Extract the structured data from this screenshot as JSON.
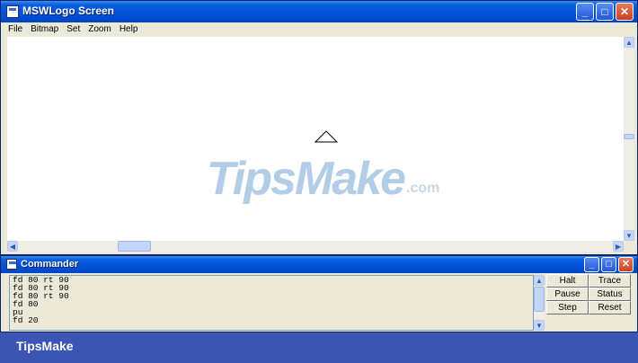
{
  "main_window": {
    "title": "MSWLogo Screen",
    "controls": {
      "minimize": "_",
      "maximize": "□",
      "close": "✕"
    },
    "menu": [
      "File",
      "Bitmap",
      "Set",
      "Zoom",
      "Help"
    ]
  },
  "canvas": {
    "watermark_main": "TipsMake",
    "watermark_suffix": ".com"
  },
  "commander": {
    "title": "Commander",
    "controls": {
      "minimize": "_",
      "maximize": "□",
      "close": "✕"
    },
    "history": [
      "fd 80 rt 90",
      "fd 80 rt 90",
      "fd 80 rt 90",
      "fd 80",
      "pu",
      "fd 20"
    ],
    "buttons": {
      "halt": "Halt",
      "trace": "Trace",
      "pause": "Pause",
      "status": "Status",
      "step": "Step",
      "reset": "Reset"
    }
  },
  "footer": {
    "brand": "TipsMake"
  },
  "colors": {
    "titlebar": "#0050d8",
    "watermark": "#b3cde6",
    "footer_bg": "#3a55b4"
  }
}
